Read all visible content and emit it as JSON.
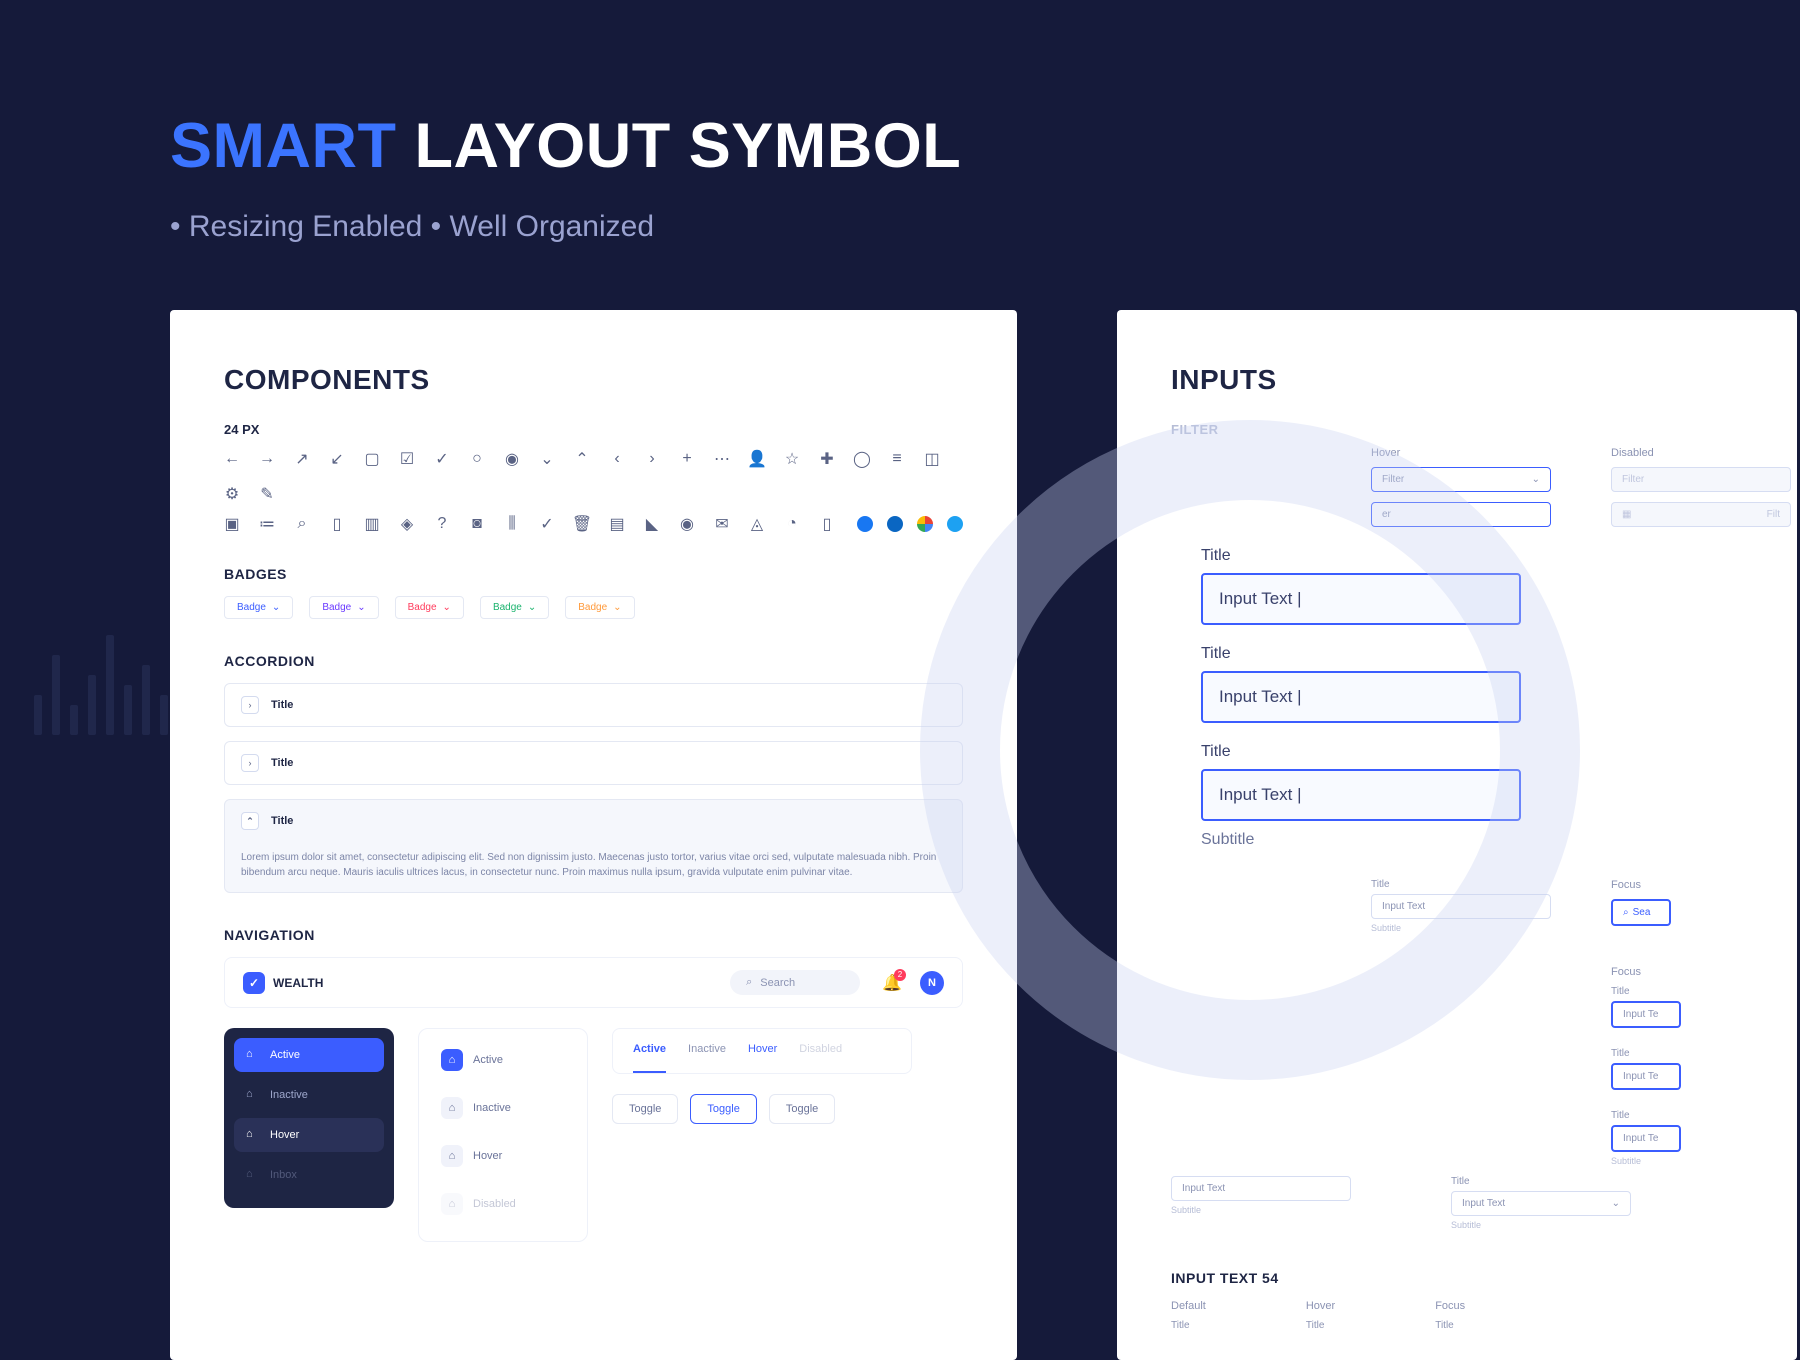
{
  "hero": {
    "smart": "SMART",
    "rest": "LAYOUT SYMBOL",
    "subtitle": "• Resizing Enabled • Well Organized"
  },
  "components": {
    "title": "COMPONENTS",
    "icon_size": "24 PX",
    "badges_label": "BADGES",
    "badges": [
      {
        "text": "Badge",
        "color": "#3b5dff"
      },
      {
        "text": "Badge",
        "color": "#6b3bff"
      },
      {
        "text": "Badge",
        "color": "#ff3b5c"
      },
      {
        "text": "Badge",
        "color": "#1bb36e"
      },
      {
        "text": "Badge",
        "color": "#ff9a3b"
      }
    ],
    "accordion_label": "ACCORDION",
    "accordion": {
      "closed": [
        "Title",
        "Title"
      ],
      "open_title": "Title",
      "open_body": "Lorem ipsum dolor sit amet, consectetur adipiscing elit. Sed non dignissim justo. Maecenas justo tortor, varius vitae orci sed, vulputate malesuada nibh. Proin bibendum arcu neque. Mauris iaculis ultrices lacus, in consectetur nunc. Proin maximus nulla ipsum, gravida vulputate enim pulvinar vitae."
    },
    "navigation_label": "NAVIGATION",
    "nav": {
      "brand": "WEALTH",
      "search_placeholder": "Search",
      "notif_count": "2",
      "avatar_letter": "N",
      "dark_items": [
        {
          "label": "Active",
          "state": "active"
        },
        {
          "label": "Inactive",
          "state": ""
        },
        {
          "label": "Hover",
          "state": "hover"
        },
        {
          "label": "Inbox",
          "state": "muted"
        }
      ],
      "light_items": [
        {
          "label": "Active",
          "state": "active"
        },
        {
          "label": "Inactive",
          "state": ""
        },
        {
          "label": "Hover",
          "state": ""
        },
        {
          "label": "Disabled",
          "state": "disabled"
        }
      ],
      "tabs": [
        "Active",
        "Inactive",
        "Hover",
        "Disabled"
      ],
      "toggles": [
        "Toggle",
        "Toggle",
        "Toggle"
      ]
    }
  },
  "inputs": {
    "title": "INPUTS",
    "filter_label": "FILTER",
    "states": {
      "hover": "Hover",
      "disabled": "Disabled",
      "focus": "Focus"
    },
    "filter_placeholder": "Filter",
    "search_short": "Sea",
    "big": [
      {
        "label": "Title",
        "value": "Input Text |"
      },
      {
        "label": "Title",
        "value": "Input Text |"
      },
      {
        "label": "Title",
        "value": "Input Text |",
        "subtitle": "Subtitle"
      }
    ],
    "small_groups": {
      "title": "Title",
      "placeholder": "Input Text",
      "subtitle": "Subtitle",
      "input_te": "Input Te"
    },
    "section54": "INPUT TEXT 54",
    "cols54": [
      "Default",
      "Hover",
      "Focus"
    ]
  }
}
